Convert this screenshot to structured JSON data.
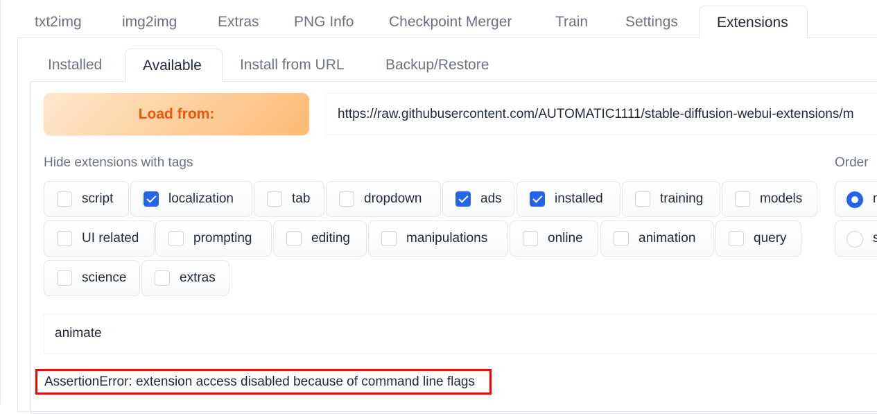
{
  "main_tabs": [
    "txt2img",
    "img2img",
    "Extras",
    "PNG Info",
    "Checkpoint Merger",
    "Train",
    "Settings",
    "Extensions"
  ],
  "active_main_tab": "Extensions",
  "sub_tabs": [
    "Installed",
    "Available",
    "Install from URL",
    "Backup/Restore"
  ],
  "active_sub_tab": "Available",
  "load_button": "Load from:",
  "url_value": "https://raw.githubusercontent.com/AUTOMATIC1111/stable-diffusion-webui-extensions/m",
  "hide_label": "Hide extensions with tags",
  "tags": [
    {
      "label": "script",
      "checked": false
    },
    {
      "label": "localization",
      "checked": true
    },
    {
      "label": "tab",
      "checked": false
    },
    {
      "label": "dropdown",
      "checked": false
    },
    {
      "label": "ads",
      "checked": true
    },
    {
      "label": "installed",
      "checked": true
    },
    {
      "label": "training",
      "checked": false
    },
    {
      "label": "models",
      "checked": false
    },
    {
      "label": "UI related",
      "checked": false
    },
    {
      "label": "prompting",
      "checked": false
    },
    {
      "label": "editing",
      "checked": false
    },
    {
      "label": "manipulations",
      "checked": false
    },
    {
      "label": "online",
      "checked": false
    },
    {
      "label": "animation",
      "checked": false
    },
    {
      "label": "query",
      "checked": false
    },
    {
      "label": "science",
      "checked": false
    },
    {
      "label": "extras",
      "checked": false
    }
  ],
  "order_label": "Order",
  "order_options": [
    {
      "label": "n",
      "selected": true
    },
    {
      "label": "s",
      "selected": false
    }
  ],
  "search_value": "animate",
  "error_message": "AssertionError: extension access disabled because of command line flags",
  "colors": {
    "accent": "#2563eb",
    "load_text": "#ea580c",
    "error_border": "#ff0000"
  }
}
